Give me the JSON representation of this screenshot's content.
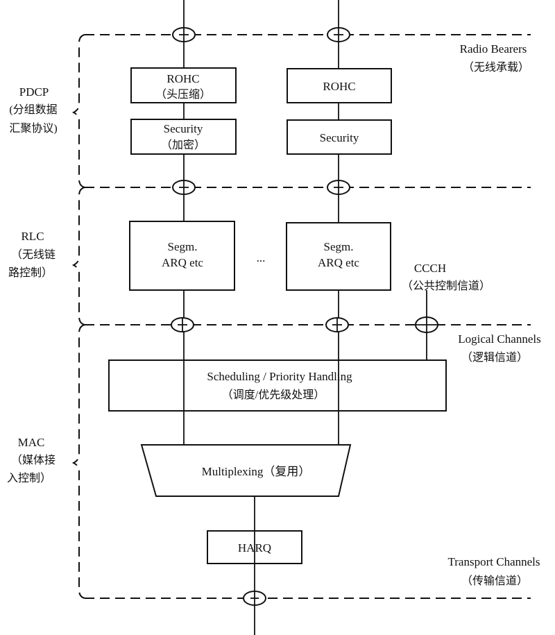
{
  "diagram": {
    "layers": [
      {
        "name": "PDCP",
        "desc_line1": "(分组数据",
        "desc_line2": "汇聚协议)"
      },
      {
        "name": "RLC",
        "desc_line1": "（无线链",
        "desc_line2": "路控制）"
      },
      {
        "name": "MAC",
        "desc_line1": "（媒体接",
        "desc_line2": "入控制）"
      }
    ],
    "channels": [
      {
        "name": "Radio Bearers",
        "desc": "（无线承载）"
      },
      {
        "name": "Logical Channels",
        "desc": "（逻辑信道）"
      },
      {
        "name": "Transport Channels",
        "desc": "（传输信道）"
      }
    ],
    "blocks": {
      "rohc_left": {
        "title": "ROHC",
        "desc": "（头压缩）"
      },
      "rohc_right": {
        "title": "ROHC"
      },
      "security_left": {
        "title": "Security",
        "desc": "（加密）"
      },
      "security_right": {
        "title": "Security"
      },
      "segm_left": {
        "line1": "Segm.",
        "line2": "ARQ etc"
      },
      "segm_right": {
        "line1": "Segm.",
        "line2": "ARQ etc"
      },
      "ellipsis": "...",
      "ccch": {
        "name": "CCCH",
        "desc": "（公共控制信道）"
      },
      "scheduling": {
        "title": "Scheduling / Priority Handling",
        "desc": "（调度/优先级处理）"
      },
      "multiplexing": {
        "title": "Multiplexing（复用）"
      },
      "harq": {
        "title": "HARQ"
      }
    }
  }
}
